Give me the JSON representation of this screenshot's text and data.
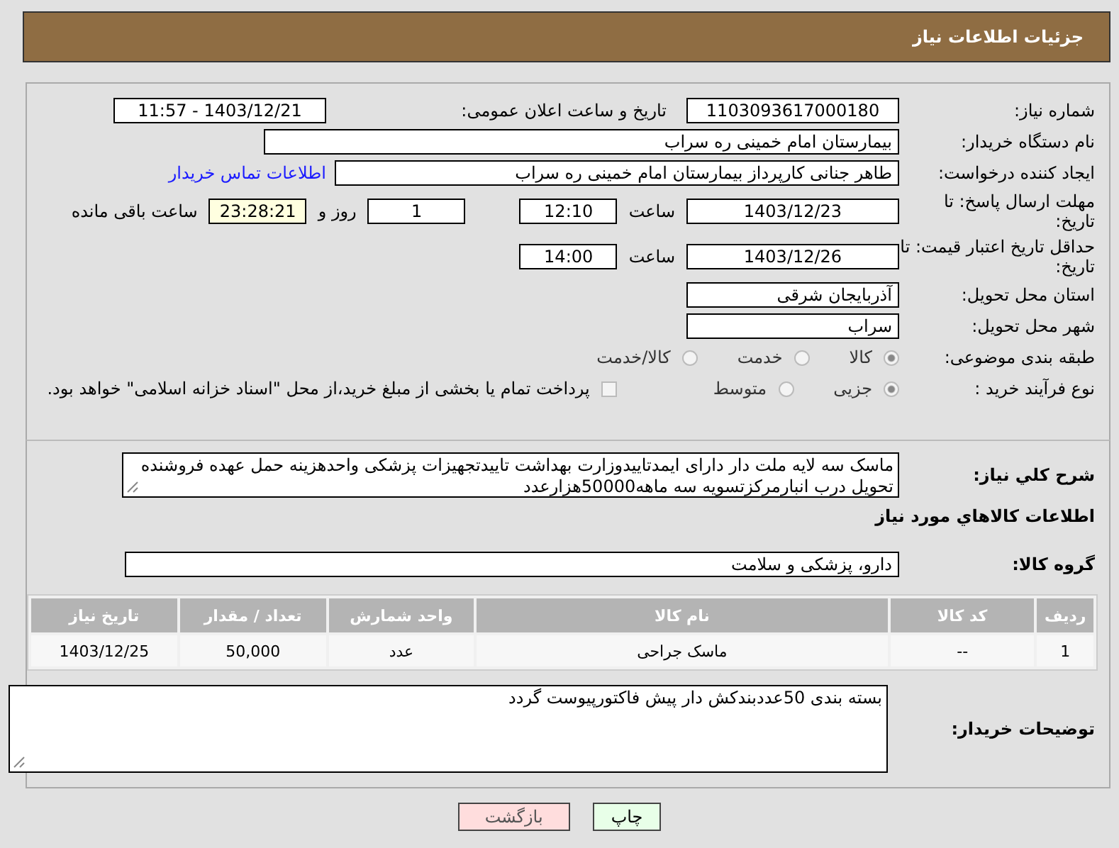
{
  "header": {
    "title": "جزئیات اطلاعات نیاز"
  },
  "need_number": {
    "label": "شماره نیاز:",
    "value": "1103093617000180"
  },
  "announce": {
    "label": "تاریخ و ساعت اعلان عمومی:",
    "value": "1403/12/21 - 11:57"
  },
  "buyer_org": {
    "label": "نام دستگاه خریدار:",
    "value": "بیمارستان امام خمینی ره  سراب"
  },
  "creator": {
    "label": "ایجاد کننده درخواست:",
    "value": "طاهر جنانی کارپرداز بیمارستان امام خمینی ره  سراب",
    "link": "اطلاعات تماس خریدار"
  },
  "reply_deadline": {
    "label": "مهلت ارسال پاسخ: تا تاریخ:",
    "date": "1403/12/23",
    "time_label": "ساعت",
    "time": "12:10",
    "days": "1",
    "days_label": "روز و",
    "remaining": "23:28:21",
    "remaining_label": "ساعت باقی مانده"
  },
  "price_validity": {
    "label": "حداقل تاریخ اعتبار قیمت: تا تاریخ:",
    "date": "1403/12/26",
    "time_label": "ساعت",
    "time": "14:00"
  },
  "province": {
    "label": "استان محل تحویل:",
    "value": "آذربایجان شرقی"
  },
  "city": {
    "label": "شهر محل تحویل:",
    "value": "سراب"
  },
  "category": {
    "label": "طبقه بندی موضوعی:",
    "options": [
      {
        "label": "کالا",
        "selected": true
      },
      {
        "label": "خدمت",
        "selected": false
      },
      {
        "label": "کالا/خدمت",
        "selected": false
      }
    ]
  },
  "process": {
    "label": "نوع فرآیند خرید :",
    "options": [
      {
        "label": "جزیی",
        "selected": true
      },
      {
        "label": "متوسط",
        "selected": false
      }
    ],
    "treasury": {
      "label": "پرداخت تمام یا بخشی از مبلغ خرید،از محل \"اسناد خزانه اسلامی\" خواهد بود.",
      "checked": false
    }
  },
  "description": {
    "label": "شرح کلي نیاز:",
    "value": "ماسک سه لایه ملت دار دارای ایمدتاییدوزارت بهداشت تاییدتجهیزات پزشکی واحدهزینه حمل عهده فروشنده تحویل درب انبارمرکزتسویه سه ماهه50000هزارعدد"
  },
  "goods_title": "اطلاعات کالاهاي مورد نیاز",
  "goods_group": {
    "label": "گروه کالا:",
    "value": "دارو، پزشکی و سلامت"
  },
  "table": {
    "columns": [
      "ردیف",
      "کد کالا",
      "نام کالا",
      "واحد شمارش",
      "تعداد / مقدار",
      "تاریخ نیاز"
    ],
    "rows": [
      [
        "1",
        "--",
        "ماسک جراحی",
        "عدد",
        "50,000",
        "1403/12/25"
      ]
    ]
  },
  "buyer_notes": {
    "label": "توضیحات خریدار:",
    "value": "بسته بندی 50عددبندکش دار پیش فاکتورپیوست گردد"
  },
  "buttons": [
    {
      "label": "چاپ",
      "kind": "print"
    },
    {
      "label": "بازگشت",
      "kind": "back"
    }
  ]
}
